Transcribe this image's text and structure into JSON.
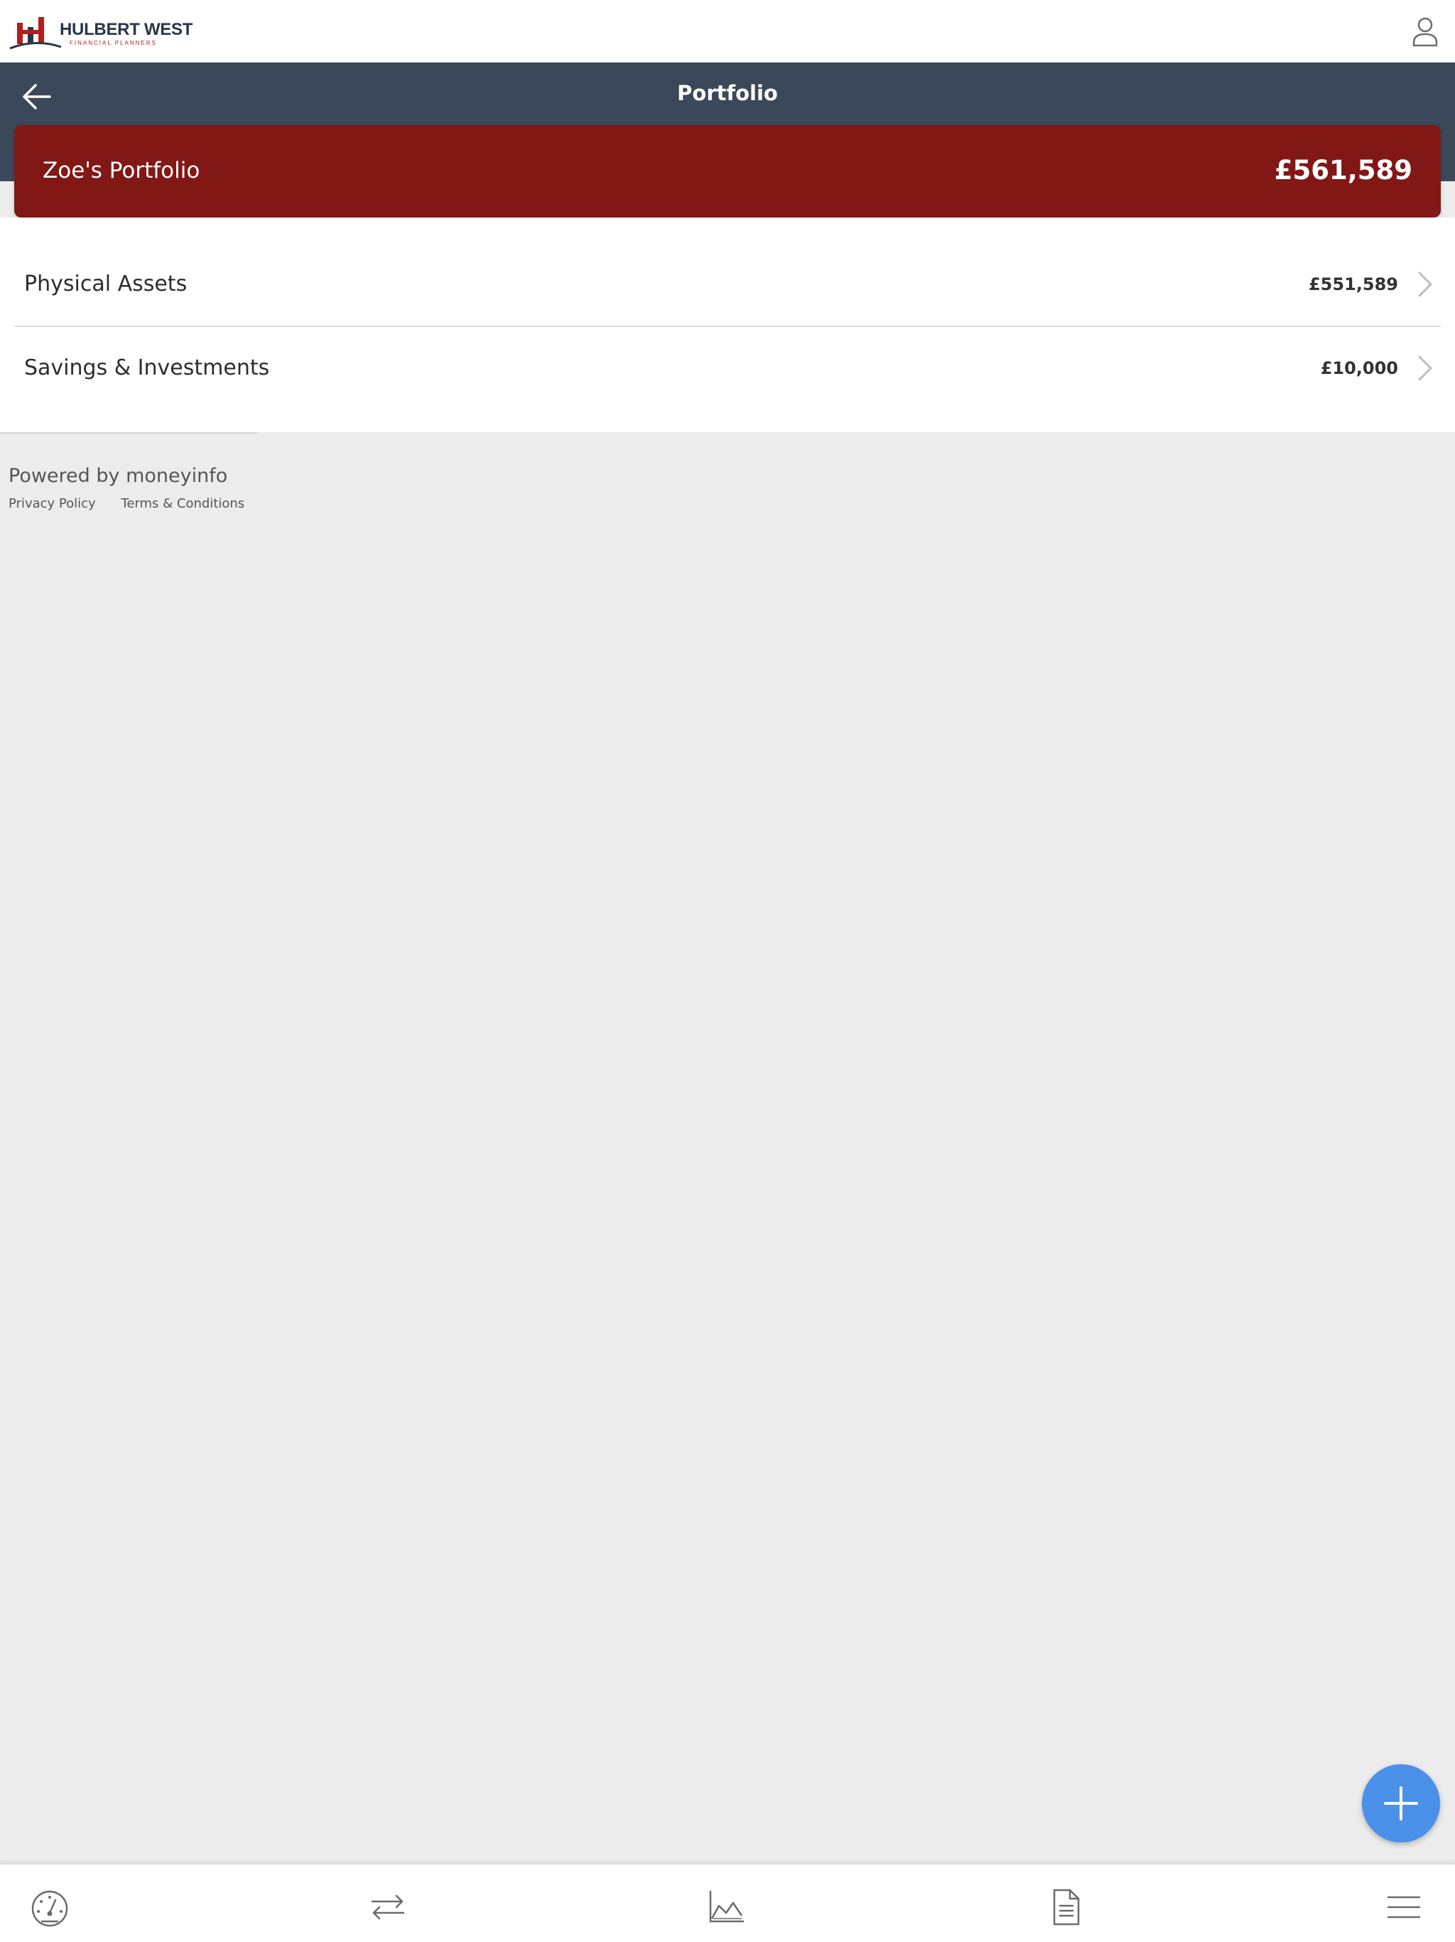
{
  "brand": {
    "name": "HULBERT WEST",
    "tagline": "FINANCIAL PLANNERS",
    "primary_color": "#821815",
    "nav_color": "#3b4859",
    "accent_color": "#4a90e8"
  },
  "header": {
    "user_icon": "user-icon"
  },
  "nav": {
    "back_icon": "back-arrow-icon",
    "title": "Portfolio"
  },
  "portfolio": {
    "name": "Zoe's Portfolio",
    "total": "£561,589"
  },
  "categories": [
    {
      "label": "Physical Assets",
      "value": "£551,589",
      "icon": "chevron-right-icon"
    },
    {
      "label": "Savings & Investments",
      "value": "£10,000",
      "icon": "chevron-right-icon"
    }
  ],
  "footer": {
    "powered_by": "Powered by moneyinfo",
    "links": [
      "Privacy Policy",
      "Terms & Conditions"
    ]
  },
  "fab": {
    "icon": "plus-icon"
  },
  "tabbar": {
    "tabs": [
      {
        "icon": "dashboard-gauge-icon"
      },
      {
        "icon": "transfer-arrows-icon"
      },
      {
        "icon": "area-chart-icon"
      },
      {
        "icon": "document-icon"
      },
      {
        "icon": "menu-icon"
      }
    ]
  }
}
